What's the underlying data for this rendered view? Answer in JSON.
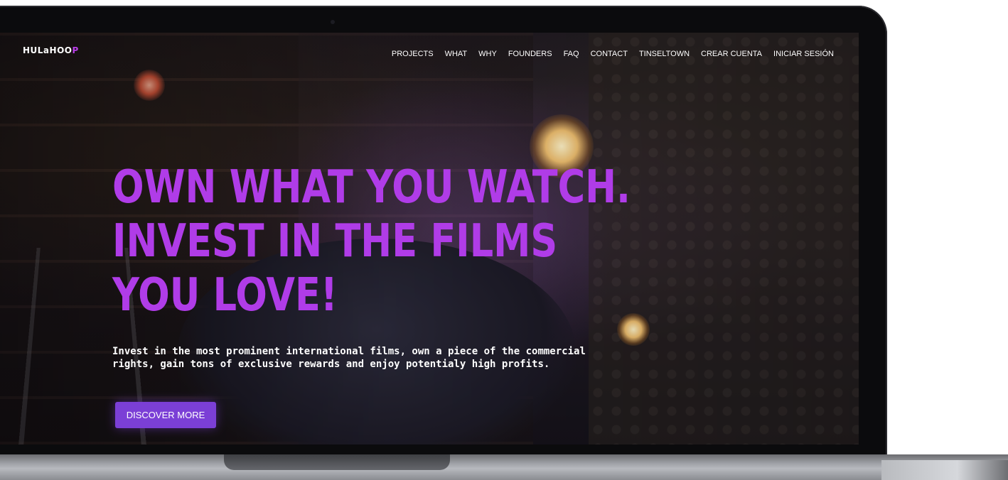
{
  "brand": {
    "logo_main": "HULaHOO",
    "logo_accent": "P"
  },
  "nav": {
    "items": [
      {
        "label": "PROJECTS"
      },
      {
        "label": "WHAT"
      },
      {
        "label": "WHY"
      },
      {
        "label": "FOUNDERS"
      },
      {
        "label": "FAQ"
      },
      {
        "label": "CONTACT"
      },
      {
        "label": "TINSELTOWN"
      },
      {
        "label": "CREAR CUENTA"
      },
      {
        "label": "INICIAR SESIÓN"
      }
    ]
  },
  "hero": {
    "title_lines": [
      "OWN WHAT YOU WATCH.",
      "INVEST IN THE FILMS",
      "YOU LOVE!"
    ],
    "subtitle": "Invest in the most prominent international films, own a piece of the commercial rights, gain tons of exclusive rewards and enjoy potentialy high profits.",
    "cta_label": "DISCOVER MORE"
  },
  "colors": {
    "accent_title": "#b03ce8",
    "button": "#7b3fd6",
    "logo_accent": "#b93ee8"
  }
}
